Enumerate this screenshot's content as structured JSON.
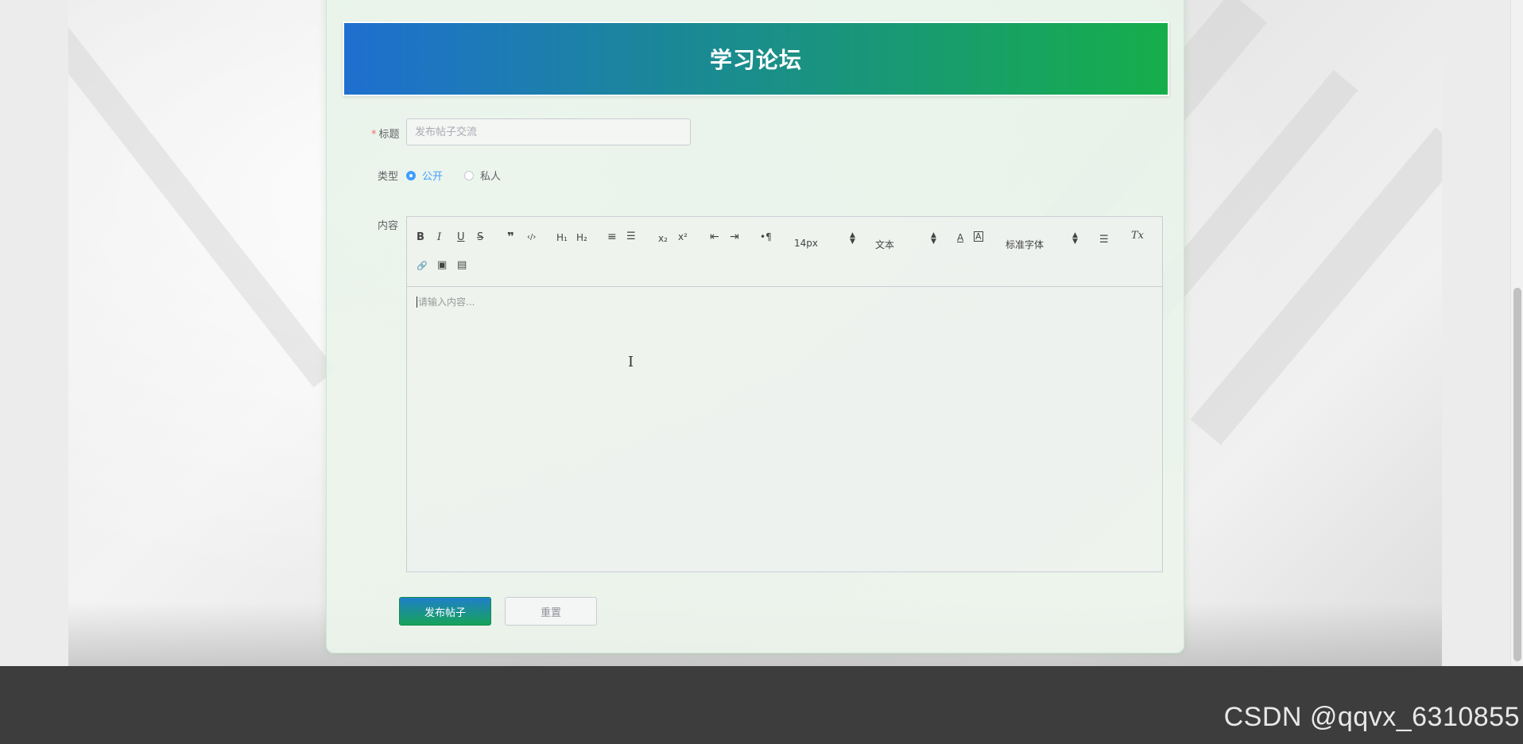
{
  "banner": {
    "title": "学习论坛"
  },
  "form": {
    "title_label": "标题",
    "title_required_mark": "*",
    "title_placeholder": "发布帖子交流",
    "type_label": "类型",
    "type_options": [
      {
        "label": "公开",
        "checked": true
      },
      {
        "label": "私人",
        "checked": false
      }
    ],
    "content_label": "内容"
  },
  "editor": {
    "toolbar": {
      "bold": "B",
      "italic": "I",
      "underline": "U",
      "strike": "S",
      "blockquote": "❞",
      "code": "‹/›",
      "h1": "H₁",
      "h2": "H₂",
      "ordered_list": "≡",
      "bullet_list": "☰",
      "subscript": "x₂",
      "superscript": "x²",
      "outdent": "⇤",
      "indent": "⇥",
      "direction": "•¶",
      "size_value": "14px",
      "header_value": "文本",
      "text_color": "A",
      "background_color": "A",
      "font_value": "标准字体",
      "align": "☰",
      "clean": "Tx",
      "link": "🔗",
      "image": "▣",
      "video": "▤",
      "arrow_up": "▲",
      "arrow_down": "▼"
    },
    "placeholder": "请输入内容..."
  },
  "buttons": {
    "submit": "发布帖子",
    "reset": "重置"
  },
  "watermark": "CSDN @qqvx_6310855",
  "colors": {
    "accent_blue": "#409eff",
    "banner_start": "#1f6fcf",
    "banner_end": "#16ae4a",
    "footer": "#3d3d3d"
  }
}
